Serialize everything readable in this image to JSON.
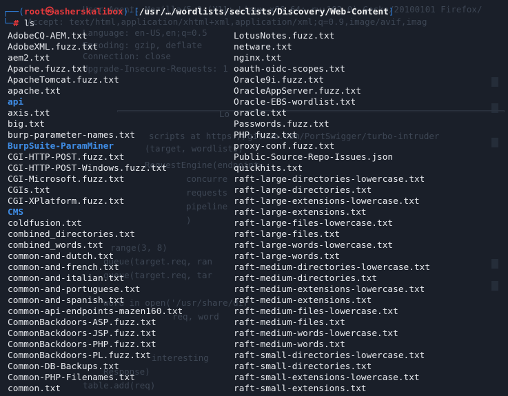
{
  "prompt": {
    "user": "root",
    "at": "㉿",
    "host": "asherskalibox",
    "path": "/usr/…/wordlists/seclists/Discovery/Web-Content",
    "symbol": "#",
    "command": "ls"
  },
  "listing": {
    "left": [
      {
        "name": "AdobeCQ-AEM.txt",
        "type": "file"
      },
      {
        "name": "AdobeXML.fuzz.txt",
        "type": "file"
      },
      {
        "name": "aem2.txt",
        "type": "file"
      },
      {
        "name": "Apache.fuzz.txt",
        "type": "file"
      },
      {
        "name": "ApacheTomcat.fuzz.txt",
        "type": "file"
      },
      {
        "name": "apache.txt",
        "type": "file"
      },
      {
        "name": "api",
        "type": "dir"
      },
      {
        "name": "axis.txt",
        "type": "file"
      },
      {
        "name": "big.txt",
        "type": "file"
      },
      {
        "name": "burp-parameter-names.txt",
        "type": "file"
      },
      {
        "name": "BurpSuite-ParamMiner",
        "type": "dir"
      },
      {
        "name": "CGI-HTTP-POST.fuzz.txt",
        "type": "file"
      },
      {
        "name": "CGI-HTTP-POST-Windows.fuzz.txt",
        "type": "file"
      },
      {
        "name": "CGI-Microsoft.fuzz.txt",
        "type": "file"
      },
      {
        "name": "CGIs.txt",
        "type": "file"
      },
      {
        "name": "CGI-XPlatform.fuzz.txt",
        "type": "file"
      },
      {
        "name": "CMS",
        "type": "dir"
      },
      {
        "name": "coldfusion.txt",
        "type": "file"
      },
      {
        "name": "combined_directories.txt",
        "type": "file"
      },
      {
        "name": "combined_words.txt",
        "type": "file"
      },
      {
        "name": "common-and-dutch.txt",
        "type": "file"
      },
      {
        "name": "common-and-french.txt",
        "type": "file"
      },
      {
        "name": "common-and-italian.txt",
        "type": "file"
      },
      {
        "name": "common-and-portuguese.txt",
        "type": "file"
      },
      {
        "name": "common-and-spanish.txt",
        "type": "file"
      },
      {
        "name": "common-api-endpoints-mazen160.txt",
        "type": "file"
      },
      {
        "name": "CommonBackdoors-ASP.fuzz.txt",
        "type": "file"
      },
      {
        "name": "CommonBackdoors-JSP.fuzz.txt",
        "type": "file"
      },
      {
        "name": "CommonBackdoors-PHP.fuzz.txt",
        "type": "file"
      },
      {
        "name": "CommonBackdoors-PL.fuzz.txt",
        "type": "file"
      },
      {
        "name": "Common-DB-Backups.txt",
        "type": "file"
      },
      {
        "name": "Common-PHP-Filenames.txt",
        "type": "file"
      },
      {
        "name": "common.txt",
        "type": "file"
      }
    ],
    "right": [
      {
        "name": "LotusNotes.fuzz.txt",
        "type": "file"
      },
      {
        "name": "netware.txt",
        "type": "file"
      },
      {
        "name": "nginx.txt",
        "type": "file"
      },
      {
        "name": "oauth-oidc-scopes.txt",
        "type": "file"
      },
      {
        "name": "Oracle9i.fuzz.txt",
        "type": "file"
      },
      {
        "name": "OracleAppServer.fuzz.txt",
        "type": "file"
      },
      {
        "name": "Oracle-EBS-wordlist.txt",
        "type": "file"
      },
      {
        "name": "oracle.txt",
        "type": "file"
      },
      {
        "name": "Passwords.fuzz.txt",
        "type": "file"
      },
      {
        "name": "PHP.fuzz.txt",
        "type": "file"
      },
      {
        "name": "proxy-conf.fuzz.txt",
        "type": "file"
      },
      {
        "name": "Public-Source-Repo-Issues.json",
        "type": "file"
      },
      {
        "name": "quickhits.txt",
        "type": "file"
      },
      {
        "name": "raft-large-directories-lowercase.txt",
        "type": "file"
      },
      {
        "name": "raft-large-directories.txt",
        "type": "file"
      },
      {
        "name": "raft-large-extensions-lowercase.txt",
        "type": "file"
      },
      {
        "name": "raft-large-extensions.txt",
        "type": "file"
      },
      {
        "name": "raft-large-files-lowercase.txt",
        "type": "file"
      },
      {
        "name": "raft-large-files.txt",
        "type": "file"
      },
      {
        "name": "raft-large-words-lowercase.txt",
        "type": "file"
      },
      {
        "name": "raft-large-words.txt",
        "type": "file"
      },
      {
        "name": "raft-medium-directories-lowercase.txt",
        "type": "file"
      },
      {
        "name": "raft-medium-directories.txt",
        "type": "file"
      },
      {
        "name": "raft-medium-extensions-lowercase.txt",
        "type": "file"
      },
      {
        "name": "raft-medium-extensions.txt",
        "type": "file"
      },
      {
        "name": "raft-medium-files-lowercase.txt",
        "type": "file"
      },
      {
        "name": "raft-medium-files.txt",
        "type": "file"
      },
      {
        "name": "raft-medium-words-lowercase.txt",
        "type": "file"
      },
      {
        "name": "raft-medium-words.txt",
        "type": "file"
      },
      {
        "name": "raft-small-directories-lowercase.txt",
        "type": "file"
      },
      {
        "name": "raft-small-directories.txt",
        "type": "file"
      },
      {
        "name": "raft-small-extensions-lowercase.txt",
        "type": "file"
      },
      {
        "name": "raft-small-extensions.txt",
        "type": "file"
      }
    ]
  },
  "background_text": [
    "User-Agent: Mozilla/5.0 (X11; Linux x86_64; rv:102.0) Gecko/20100101 Firefox/",
    "Accept: text/html,application/xhtml+xml,application/xml;q=0.9,image/avif,imag",
    "Language: en-US,en;q=0.5",
    "Encoding: gzip, deflate",
    "Connection: close",
    "Upgrade-Insecure-Requests: 1",
    "Lo",
    "scripts at https://github.com/PortSwigger/turbo-intruder",
    "(target, wordlists)",
    "RequestEngine(endpoint=",
    "concurre",
    "requests",
    "pipeline",
    ")",
    "range(3, 8)",
    "queue(target.req, ran",
    "queue(target.req, tar",
    "word in open('/usr/share/dir",
    "req, word",
    "interesting",
    "Response)",
    "table.add(req)"
  ]
}
